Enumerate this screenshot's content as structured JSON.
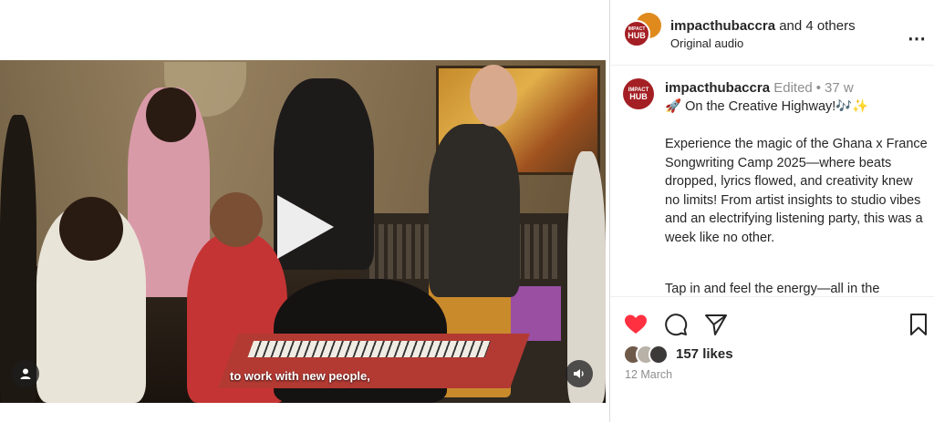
{
  "post": {
    "header": {
      "username": "impacthubaccra",
      "others": "and 4 others",
      "audio": "Original audio",
      "more_icon": "⋯"
    },
    "avatar_text": {
      "small": "IMPACT",
      "big": "HUB"
    },
    "caption": {
      "username": "impacthubaccra",
      "edited": "Edited",
      "dot": "•",
      "age": "37 w",
      "headline": "🚀 On the Creative Highway!🎶✨",
      "body": "Experience the magic of the Ghana x France Songwriting Camp 2025—where beats dropped, lyrics flowed, and creativity knew no limits! From artist insights to studio vibes and an electrifying listening party, this was a week like no other.",
      "more": "Tap in and feel the energy—all in the"
    },
    "likes": "157 likes",
    "date": "12 March"
  },
  "video": {
    "subtitle": "to work with new people,"
  },
  "icons": {
    "play": "play-icon",
    "user_tag": "user-icon",
    "mute": "speaker-icon",
    "like": "heart-icon",
    "comment": "comment-icon",
    "share": "send-icon",
    "save": "bookmark-icon"
  },
  "colors": {
    "like_red": "#ff3040",
    "brand_red": "#a41f24",
    "muted_text": "#8e8e8e"
  }
}
